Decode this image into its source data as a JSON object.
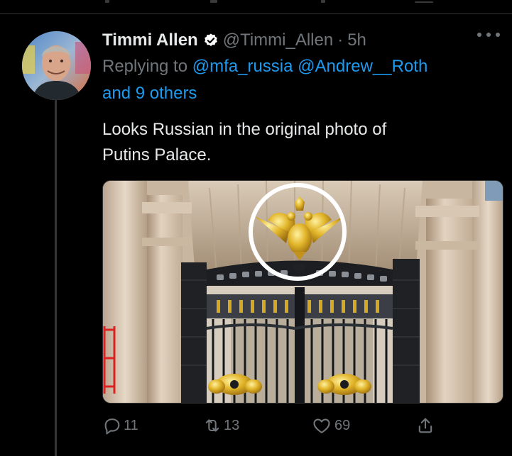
{
  "tweet": {
    "author_name": "Timmi Allen",
    "handle": "@Timmi_Allen",
    "separator": "·",
    "time": "5h",
    "verified": true,
    "replying_prefix": "Replying to ",
    "replying_to": [
      "@mfa_russia",
      "@Andrew__Roth"
    ],
    "replying_others": "and 9 others",
    "text_line1": "Looks Russian in the original photo of",
    "text_line2": "Putins Palace.",
    "media_description_icon": "palace-gate-photo",
    "stats": {
      "replies": "11",
      "retweets": "13",
      "likes": "69"
    }
  },
  "colors": {
    "background": "#000000",
    "primary_text": "#e7e9ea",
    "secondary_text": "#71767b",
    "link": "#1d9bf0",
    "divider": "#2f3336"
  },
  "icons": {
    "verified": "verified-badge-icon",
    "more": "more-dots-icon",
    "reply": "reply-icon",
    "retweet": "retweet-icon",
    "like": "heart-icon",
    "share": "share-icon"
  }
}
